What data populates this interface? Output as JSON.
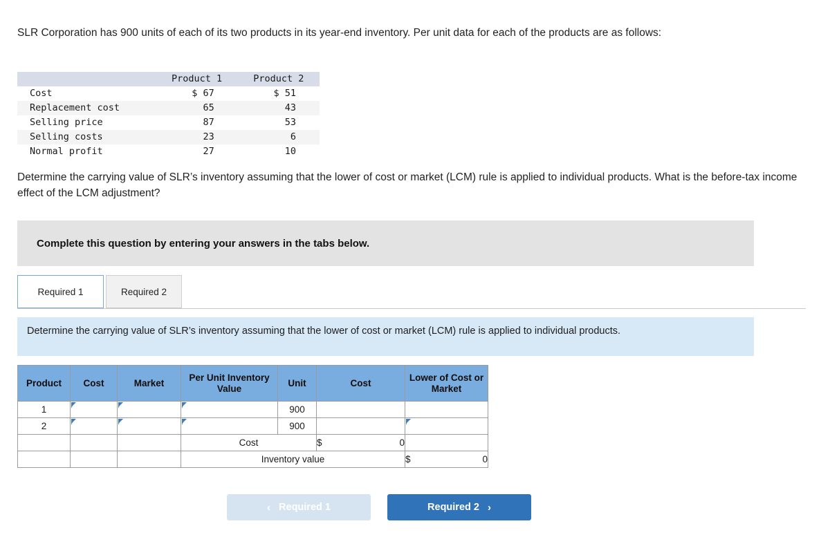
{
  "intro": {
    "text": "SLR Corporation has 900 units of each of its two products in its year-end inventory. Per unit data for each of the products are as follows:"
  },
  "data_table": {
    "columns": [
      "",
      "Product 1",
      "Product 2"
    ],
    "rows": [
      {
        "label": "Cost",
        "product1": "$ 67",
        "product2": "$ 51"
      },
      {
        "label": "Replacement cost",
        "product1": "65",
        "product2": "43"
      },
      {
        "label": "Selling price",
        "product1": "87",
        "product2": "53"
      },
      {
        "label": "Selling costs",
        "product1": "23",
        "product2": "6"
      },
      {
        "label": "Normal profit",
        "product1": "27",
        "product2": "10"
      }
    ]
  },
  "question": {
    "text": "Determine the carrying value of SLR’s inventory assuming that the lower of cost or market (LCM) rule is applied to individual products. What is the before-tax income effect of the LCM adjustment?"
  },
  "banner": {
    "text": "Complete this question by entering your answers in the tabs below."
  },
  "tabs": [
    {
      "label": "Required 1",
      "active": true
    },
    {
      "label": "Required 2",
      "active": false
    }
  ],
  "instruction": {
    "text": "Determine the carrying value of SLR’s inventory assuming that the lower of cost or market (LCM) rule is applied to individual products."
  },
  "answer_table": {
    "headers": {
      "product": "Product",
      "cost": "Cost",
      "market": "Market",
      "per_unit_inventory_value": "Per Unit Inventory Value",
      "unit": "Unit",
      "cost2": "Cost",
      "lower_of_cost_or_market": "Lower of Cost or Market"
    },
    "rows": [
      {
        "product": "1",
        "cost": "",
        "market": "",
        "per_unit_inventory_value": "",
        "unit": "900",
        "cost2": "",
        "lower_of_cost_or_market": ""
      },
      {
        "product": "2",
        "cost": "",
        "market": "",
        "per_unit_inventory_value": "",
        "unit": "900",
        "cost2": "",
        "lower_of_cost_or_market": ""
      }
    ],
    "totals": [
      {
        "label": "Cost",
        "currency": "$",
        "value": "0"
      },
      {
        "label": "Inventory value",
        "currency": "$",
        "value": "0"
      }
    ]
  },
  "nav": {
    "prev_label": "Required 1",
    "prev_chevron": "‹",
    "next_label": "Required 2",
    "next_chevron": "›"
  },
  "colors": {
    "header_blue": "#7aaddf",
    "primary_button": "#3173b8",
    "disabled_button": "#d6e4f2",
    "info_box": "#d7e9f7",
    "banner_grey": "#e3e3e3",
    "total_yellow": "#fbf8c8",
    "input_border": "#4a7fb5"
  }
}
